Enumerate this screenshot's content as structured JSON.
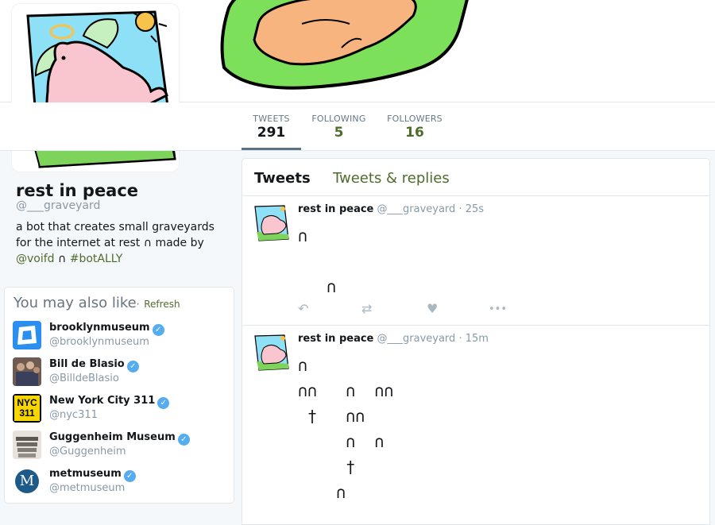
{
  "profile": {
    "name": "rest in peace",
    "handle": "@___graveyard",
    "bio_text": "a bot that creates small graveyards for the internet at rest ∩ made by",
    "bio_mention": "@voifd",
    "bio_sep": "∩",
    "bio_hashtag": "#botALLY"
  },
  "stats": [
    {
      "label": "TWEETS",
      "value": "291"
    },
    {
      "label": "FOLLOWING",
      "value": "5"
    },
    {
      "label": "FOLLOWERS",
      "value": "16"
    }
  ],
  "who_to_follow": {
    "title": "You may also like",
    "dot": "·",
    "refresh": "Refresh",
    "accounts": [
      {
        "name": "brooklynmuseum",
        "handle": "@brooklynmuseum"
      },
      {
        "name": "Bill de Blasio",
        "handle": "@BilldeBlasio"
      },
      {
        "name": "New York City 311",
        "handle": "@nyc311"
      },
      {
        "name": "Guggenheim Museum",
        "handle": "@Guggenheim"
      },
      {
        "name": "metmuseum",
        "handle": "@metmuseum"
      }
    ],
    "nyc_logo_line1": "NYC",
    "nyc_logo_line2": "311",
    "met_logo": "M"
  },
  "timeline": {
    "tabs": [
      "Tweets",
      "Tweets & replies"
    ],
    "tweets": [
      {
        "name": "rest in peace",
        "handle": "@___graveyard",
        "time": "25s",
        "body": "∩\n\n   ∩"
      },
      {
        "name": "rest in peace",
        "handle": "@___graveyard",
        "time": "15m",
        "body": "∩\n∩∩   ∩  ∩∩\n †   ∩∩\n     ∩  ∩\n     †\n    ∩"
      }
    ],
    "dot": "·"
  },
  "icons": {
    "reply": "↶",
    "retweet": "⇄",
    "like": "♥",
    "more": "•••",
    "verified": "✓"
  },
  "colors": {
    "accent": "#4f6b2d",
    "verified": "#55acee",
    "muted": "#8899a6"
  }
}
